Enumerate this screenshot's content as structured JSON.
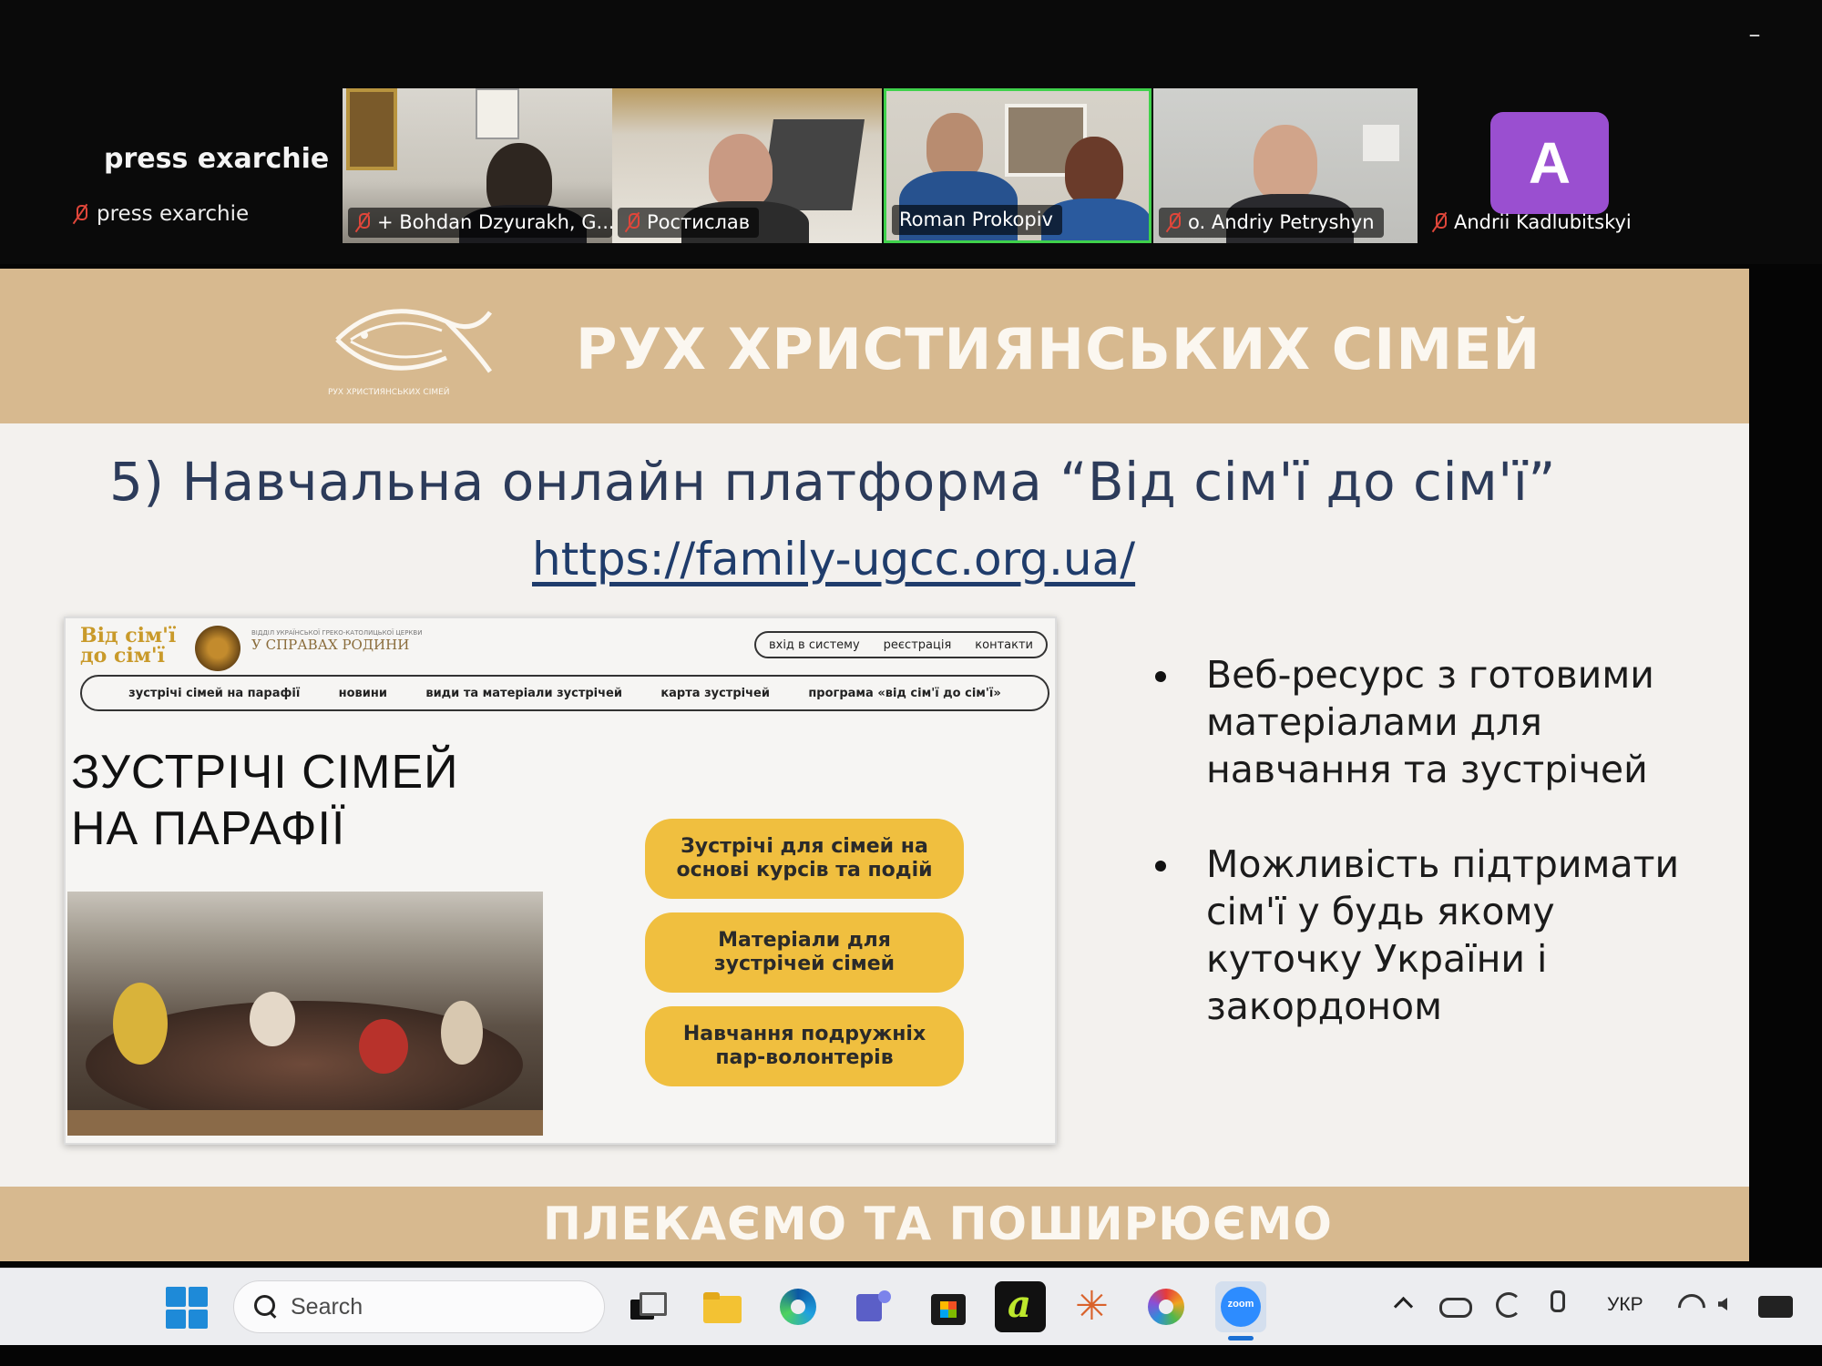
{
  "zoom": {
    "host_display_name": "press exarchie",
    "host_label": "press exarchie",
    "participants": [
      {
        "name": "+ Bohdan Dzyurakh, G..."
      },
      {
        "name": "Ростислав"
      },
      {
        "name": "Roman Prokopiv"
      },
      {
        "name": "o. Andriy Petryshyn"
      },
      {
        "name": "Andrii Kadlubitskyi",
        "avatar_letter": "A",
        "avatar_color": "#9a4fd0"
      }
    ],
    "active_speaker_color": "#3fd14b",
    "minimize_glyph": "–"
  },
  "slide": {
    "header_title": "РУХ ХРИСТИЯНСЬКИХ СІМЕЙ",
    "logo_text": "РУХ ХРИСТИЯНСЬКИХ СІМЕЙ",
    "heading": "5) Навчальна онлайн платформа “Від сім'ї до сім'ї”",
    "link": "https://family-ugcc.org.ua/",
    "website": {
      "logo_line1": "Від сім'ї",
      "logo_line2": "до сім'ї",
      "emblem_small": "ВІДДІЛ УКРАЇНСЬКОЇ ГРЕКО-КАТОЛИЦЬКОЇ ЦЕРКВИ",
      "emblem_name": "У СПРАВАХ РОДИНИ",
      "top_links": [
        "вхід в систему",
        "реєстрація",
        "контакти"
      ],
      "nav": [
        "зустрічі сімей на парафії",
        "новини",
        "види та матеріали зустрічей",
        "карта зустрічей",
        "програма «від сім'ї до сім'ї»"
      ],
      "big_title_line1": "ЗУСТРІЧІ СІМЕЙ",
      "big_title_line2": "НА ПАРАФІЇ",
      "buttons": [
        "Зустрічі для сімей на основі курсів та подій",
        "Матеріали для зустрічей сімей",
        "Навчання подружніх пар-волонтерів"
      ],
      "button_color": "#f0bf3f"
    },
    "bullets": [
      "Веб-ресурс з готовими матеріалами для навчання та зустрічей",
      "Можливість підтримати сім'ї у будь якому куточку України і закордоном"
    ],
    "footer": "ПЛЕКАЄМО ТА ПОШИРЮЄМО",
    "band_color": "#d7b98f"
  },
  "taskbar": {
    "search_placeholder": "Search",
    "apps": [
      "start-icon",
      "task-view-icon",
      "file-explorer-icon",
      "edge-icon",
      "teams-icon",
      "store-icon",
      "a-app-icon",
      "claude-icon",
      "photos-icon",
      "zoom-icon"
    ],
    "zoom_label": "zoom",
    "a_app_letter": "a",
    "claude_glyph": "✳",
    "language": "УКР"
  }
}
